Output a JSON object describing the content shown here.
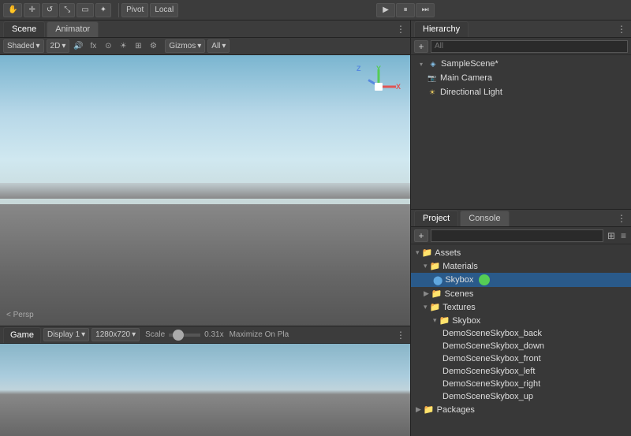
{
  "topToolbar": {
    "tools": [
      "hand",
      "move",
      "rotate",
      "scale",
      "rect",
      "transform"
    ],
    "pivot": "Pivot",
    "local": "Local",
    "playButton": "▶",
    "pauseButton": "⏸",
    "stepButton": "⏭"
  },
  "sceneTabs": {
    "scene": "Scene",
    "animator": "Animator"
  },
  "sceneToolbar": {
    "shadingMode": "Shaded",
    "viewMode": "2D",
    "gizmosLabel": "Gizmos",
    "allLabel": "All"
  },
  "viewport": {
    "perspLabel": "< Persp",
    "gizmoX": "X",
    "gizmoY": "Y",
    "gizmoZ": "Z"
  },
  "gamePanel": {
    "tabLabel": "Game",
    "displayLabel": "Display 1",
    "resolution": "1280x720",
    "scaleLabel": "Scale",
    "scaleValue": "0.31x",
    "maximizeLabel": "Maximize On Pla"
  },
  "hierarchy": {
    "tabLabel": "Hierarchy",
    "searchPlaceholder": "All",
    "items": [
      {
        "label": "SampleScene*",
        "type": "scene",
        "indent": 0,
        "expanded": true
      },
      {
        "label": "Main Camera",
        "type": "camera",
        "indent": 1
      },
      {
        "label": "Directional Light",
        "type": "light",
        "indent": 1
      }
    ]
  },
  "project": {
    "tabLabel": "Project",
    "consoleTabLabel": "Console",
    "searchPlaceholder": "",
    "tree": [
      {
        "label": "Assets",
        "type": "folder",
        "indent": 0,
        "expanded": true
      },
      {
        "label": "Materials",
        "type": "folder",
        "indent": 1,
        "expanded": true
      },
      {
        "label": "Skybox",
        "type": "asset",
        "indent": 2,
        "selected": true
      },
      {
        "label": "Scenes",
        "type": "folder",
        "indent": 1,
        "expanded": false
      },
      {
        "label": "Textures",
        "type": "folder",
        "indent": 1,
        "expanded": true
      },
      {
        "label": "Skybox",
        "type": "folder",
        "indent": 2,
        "expanded": true
      },
      {
        "label": "DemoSceneSkybox_back",
        "type": "file",
        "indent": 3
      },
      {
        "label": "DemoSceneSkybox_down",
        "type": "file",
        "indent": 3
      },
      {
        "label": "DemoSceneSkybox_front",
        "type": "file",
        "indent": 3
      },
      {
        "label": "DemoSceneSkybox_left",
        "type": "file",
        "indent": 3
      },
      {
        "label": "DemoSceneSkybox_right",
        "type": "file",
        "indent": 3
      },
      {
        "label": "DemoSceneSkybox_up",
        "type": "file",
        "indent": 3
      },
      {
        "label": "Packages",
        "type": "folder",
        "indent": 0,
        "expanded": false
      }
    ]
  }
}
